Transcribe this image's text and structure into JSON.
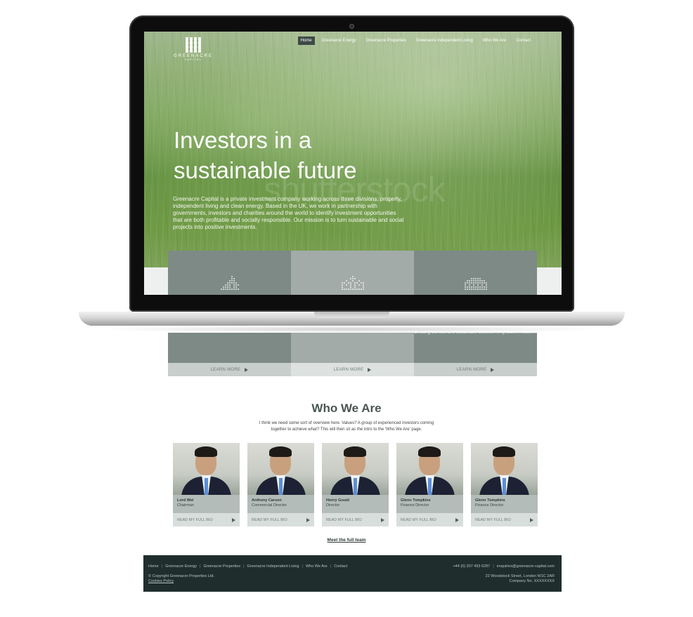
{
  "site": {
    "logo_text": "GREENACRE",
    "logo_sub": "CAPITAL",
    "nav": [
      "Home",
      "Greenacre Energy",
      "Greenacre Properties",
      "Greenacre Independent Living",
      "Who We Are",
      "Contact"
    ],
    "watermark": "shutterstock"
  },
  "hero": {
    "title": "Investors in a sustainable future",
    "text": "Greenacre Capital is a private investment company working across three divisions: property, independent living and clean energy. Based in the UK, we work in partnership with governments, investors and charities around the world to identify investment opportunities that are both profitable and socially responsible. Our mission is to turn sustainable and social projects into positive investments."
  },
  "divisions": [
    {
      "icon": "wind-turbine-dots-icon",
      "description": "",
      "learn": "LEARN MORE"
    },
    {
      "icon": "house-dots-icon",
      "description": "",
      "learn": "LEARN MORE"
    },
    {
      "icon": "building-dots-icon",
      "description": "Creating low cost and sustainable assisted living accommodation.",
      "learn": "LEARN MORE"
    }
  ],
  "who": {
    "title": "Who We Are",
    "intro": "I think we need some sort of overview here. Values? A group of experienced investors coming together to achieve what? This will then sit as the intro to the 'Who We Are' page.",
    "members": [
      {
        "name": "Lord Wei",
        "role": "Chairman",
        "bio": "READ MY FULL BIO"
      },
      {
        "name": "Anthony Carson",
        "role": "Commercial Director",
        "bio": "READ MY FULL BIO"
      },
      {
        "name": "Henry Gould",
        "role": "Director",
        "bio": "READ MY FULL BIO"
      },
      {
        "name": "Glenn Tompkins",
        "role": "Finance Director",
        "bio": "READ MY FULL BIO"
      },
      {
        "name": "Glenn Tompkins",
        "role": "Finance Director",
        "bio": "READ MY FULL BIO"
      }
    ],
    "meet_team": "Meet the full team"
  },
  "footer": {
    "nav": [
      "Home",
      "Greenacre Energy",
      "Greenacre Properties",
      "Greenacre Independent Living",
      "Who We Are",
      "Contact"
    ],
    "phone": "+44 (0) 207 493 6287",
    "email": "enquiries@greenacre-capital.com",
    "copyright": "© Copyright Greenacre Properties Ltd.",
    "cookies": "Cookies Policy",
    "address": "22 Woodstock Street, London W1C 2AR",
    "company": "Company No. XXXXXXXX"
  },
  "colors": {
    "footer_bg": "#1f2e2d",
    "card_dark": "#7d8a86",
    "card_light": "#a2aba7",
    "nav_active": "#3e4a47"
  }
}
